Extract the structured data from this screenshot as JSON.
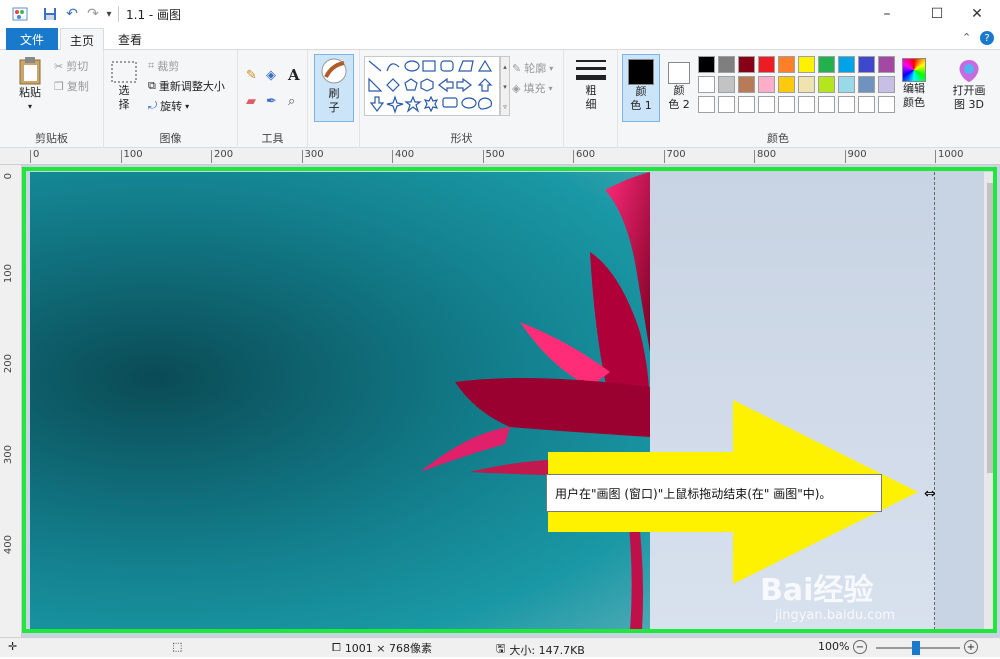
{
  "window": {
    "title": "1.1 - 画图",
    "minimize": "–",
    "maximize": "☐",
    "close": "✕"
  },
  "tabs": {
    "file": "文件",
    "home": "主页",
    "view": "查看"
  },
  "ribbon": {
    "clipboard": {
      "label": "剪贴板",
      "paste": "粘贴",
      "cut": "剪切",
      "copy": "复制"
    },
    "image": {
      "label": "图像",
      "select": "选",
      "select2": "择",
      "crop": "裁剪",
      "resize": "重新调整大小",
      "rotate": "旋转"
    },
    "tools": {
      "label": "工具"
    },
    "brush": {
      "label1": "刷",
      "label2": "子"
    },
    "shapes": {
      "label": "形状",
      "outline": "轮廓",
      "fill": "填充"
    },
    "size": {
      "label1": "粗",
      "label2": "细"
    },
    "colors": {
      "label": "颜色",
      "color1a": "颜",
      "color1b": "色 1",
      "color2a": "颜",
      "color2b": "色 2",
      "edit1": "编辑",
      "edit2": "颜色",
      "paint3d1": "打开画",
      "paint3d2": "图 3D",
      "row1": [
        "#000000",
        "#7f7f7f",
        "#880015",
        "#ed1c24",
        "#ff7f27",
        "#fff200",
        "#22b14c",
        "#00a2e8",
        "#3f48cc",
        "#a349a4"
      ],
      "row2": [
        "#ffffff",
        "#c3c3c3",
        "#b97a57",
        "#ffaec9",
        "#ffc90e",
        "#efe4b0",
        "#b5e61d",
        "#99d9ea",
        "#7092be",
        "#c8bfe7"
      ],
      "row3": [
        "#ffffff",
        "#ffffff",
        "#ffffff",
        "#ffffff",
        "#ffffff",
        "#ffffff",
        "#ffffff",
        "#ffffff",
        "#ffffff",
        "#ffffff"
      ]
    }
  },
  "ruler": {
    "h": [
      "0",
      "100",
      "200",
      "300",
      "400",
      "500",
      "600",
      "700",
      "800",
      "900",
      "1000"
    ],
    "v": [
      "0",
      "100",
      "200",
      "300",
      "400"
    ]
  },
  "tooltip": "用户在\"画图 (窗口)\"上鼠标拖动结束(在\" 画图\"中)。",
  "status": {
    "dimensions": "1001 × 768像素",
    "size": "大小: 147.7KB",
    "zoom": "100%"
  },
  "watermark": {
    "main": "Bai经验",
    "sub": "jingyan.baidu.com"
  }
}
